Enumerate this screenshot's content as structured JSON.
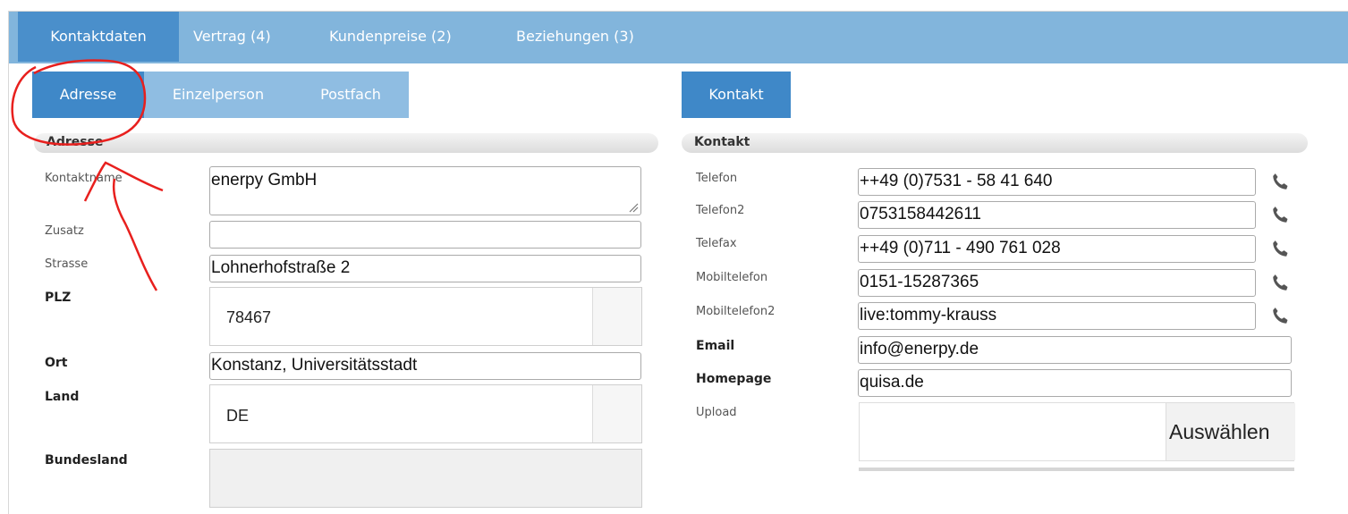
{
  "tabs": [
    {
      "label": "Kontaktdaten"
    },
    {
      "label": "Vertrag (4)"
    },
    {
      "label": "Kundenpreise (2)"
    },
    {
      "label": "Beziehungen (3)"
    }
  ],
  "left_subtabs": [
    {
      "label": "Adresse"
    },
    {
      "label": "Einzelperson"
    },
    {
      "label": "Postfach"
    }
  ],
  "right_subtabs": [
    {
      "label": "Kontakt"
    }
  ],
  "adresse": {
    "section_title": "Adresse",
    "kontaktname_label": "Kontaktname",
    "kontaktname_value": "enerpy GmbH",
    "zusatz_label": "Zusatz",
    "zusatz_value": "",
    "strasse_label": "Strasse",
    "strasse_value": "Lohnerhofstraße 2",
    "plz_label": "PLZ",
    "plz_value": "78467",
    "ort_label": "Ort",
    "ort_value": "Konstanz, Universitätsstadt",
    "land_label": "Land",
    "land_value": "DE",
    "bundesland_label": "Bundesland",
    "bundesland_value": ""
  },
  "kontakt": {
    "section_title": "Kontakt",
    "telefon_label": "Telefon",
    "telefon_value": "++49 (0)7531 - 58 41 640",
    "telefon2_label": "Telefon2",
    "telefon2_value": "0753158442611",
    "telefax_label": "Telefax",
    "telefax_value": "++49 (0)711 - 490 761 028",
    "mobil_label": "Mobiltelefon",
    "mobil_value": "0151-15287365",
    "mobil2_label": "Mobiltelefon2",
    "mobil2_value": "live:tommy-krauss",
    "email_label": "Email",
    "email_value": "info@enerpy.de",
    "homepage_label": "Homepage",
    "homepage_value": "quisa.de",
    "upload_label": "Upload",
    "upload_button": "Auswählen"
  },
  "icons": {
    "phone": "phone-icon"
  },
  "colors": {
    "topbar": "#82b5dc",
    "active_tab": "#4a8fcb",
    "annotation": "#e8201e"
  }
}
